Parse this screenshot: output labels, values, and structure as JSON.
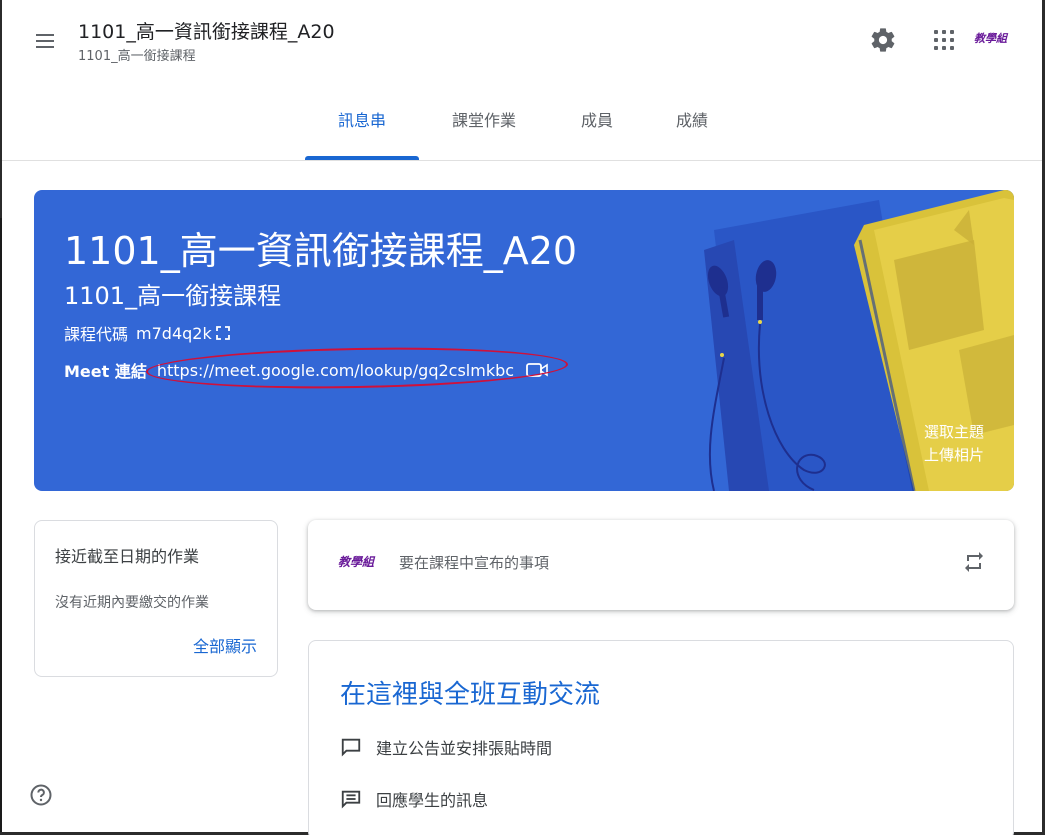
{
  "header": {
    "course_title": "1101_高一資訊銜接課程_A20",
    "course_subtitle": "1101_高一銜接課程",
    "avatar_text": "教學組",
    "icons": [
      "menu-icon",
      "settings-gear-icon",
      "apps-grid-icon"
    ]
  },
  "tabs": [
    {
      "label": "訊息串",
      "active": true
    },
    {
      "label": "課堂作業",
      "active": false
    },
    {
      "label": "成員",
      "active": false
    },
    {
      "label": "成績",
      "active": false
    }
  ],
  "banner": {
    "title": "1101_高一資訊銜接課程_A20",
    "subtitle": "1101_高一銜接課程",
    "class_code_label": "課程代碼",
    "class_code": "m7d4q2k",
    "meet_label": "Meet 連結",
    "meet_link": "https://meet.google.com/lookup/gq2cslmkbc",
    "select_theme": "選取主題",
    "upload_photo": "上傳相片",
    "color": "#3367d6"
  },
  "upcoming": {
    "title": "接近截至日期的作業",
    "empty_text": "沒有近期內要繳交的作業",
    "view_all": "全部顯示"
  },
  "announce": {
    "avatar_text": "教學組",
    "placeholder": "要在課程中宣布的事項"
  },
  "stream": {
    "title": "在這裡與全班互動交流",
    "items": [
      {
        "label": "建立公告並安排張貼時間",
        "icon": "announcement-icon"
      },
      {
        "label": "回應學生的訊息",
        "icon": "message-icon"
      }
    ]
  },
  "colors": {
    "accent": "#1967d2",
    "annotation": "#d0103a"
  }
}
